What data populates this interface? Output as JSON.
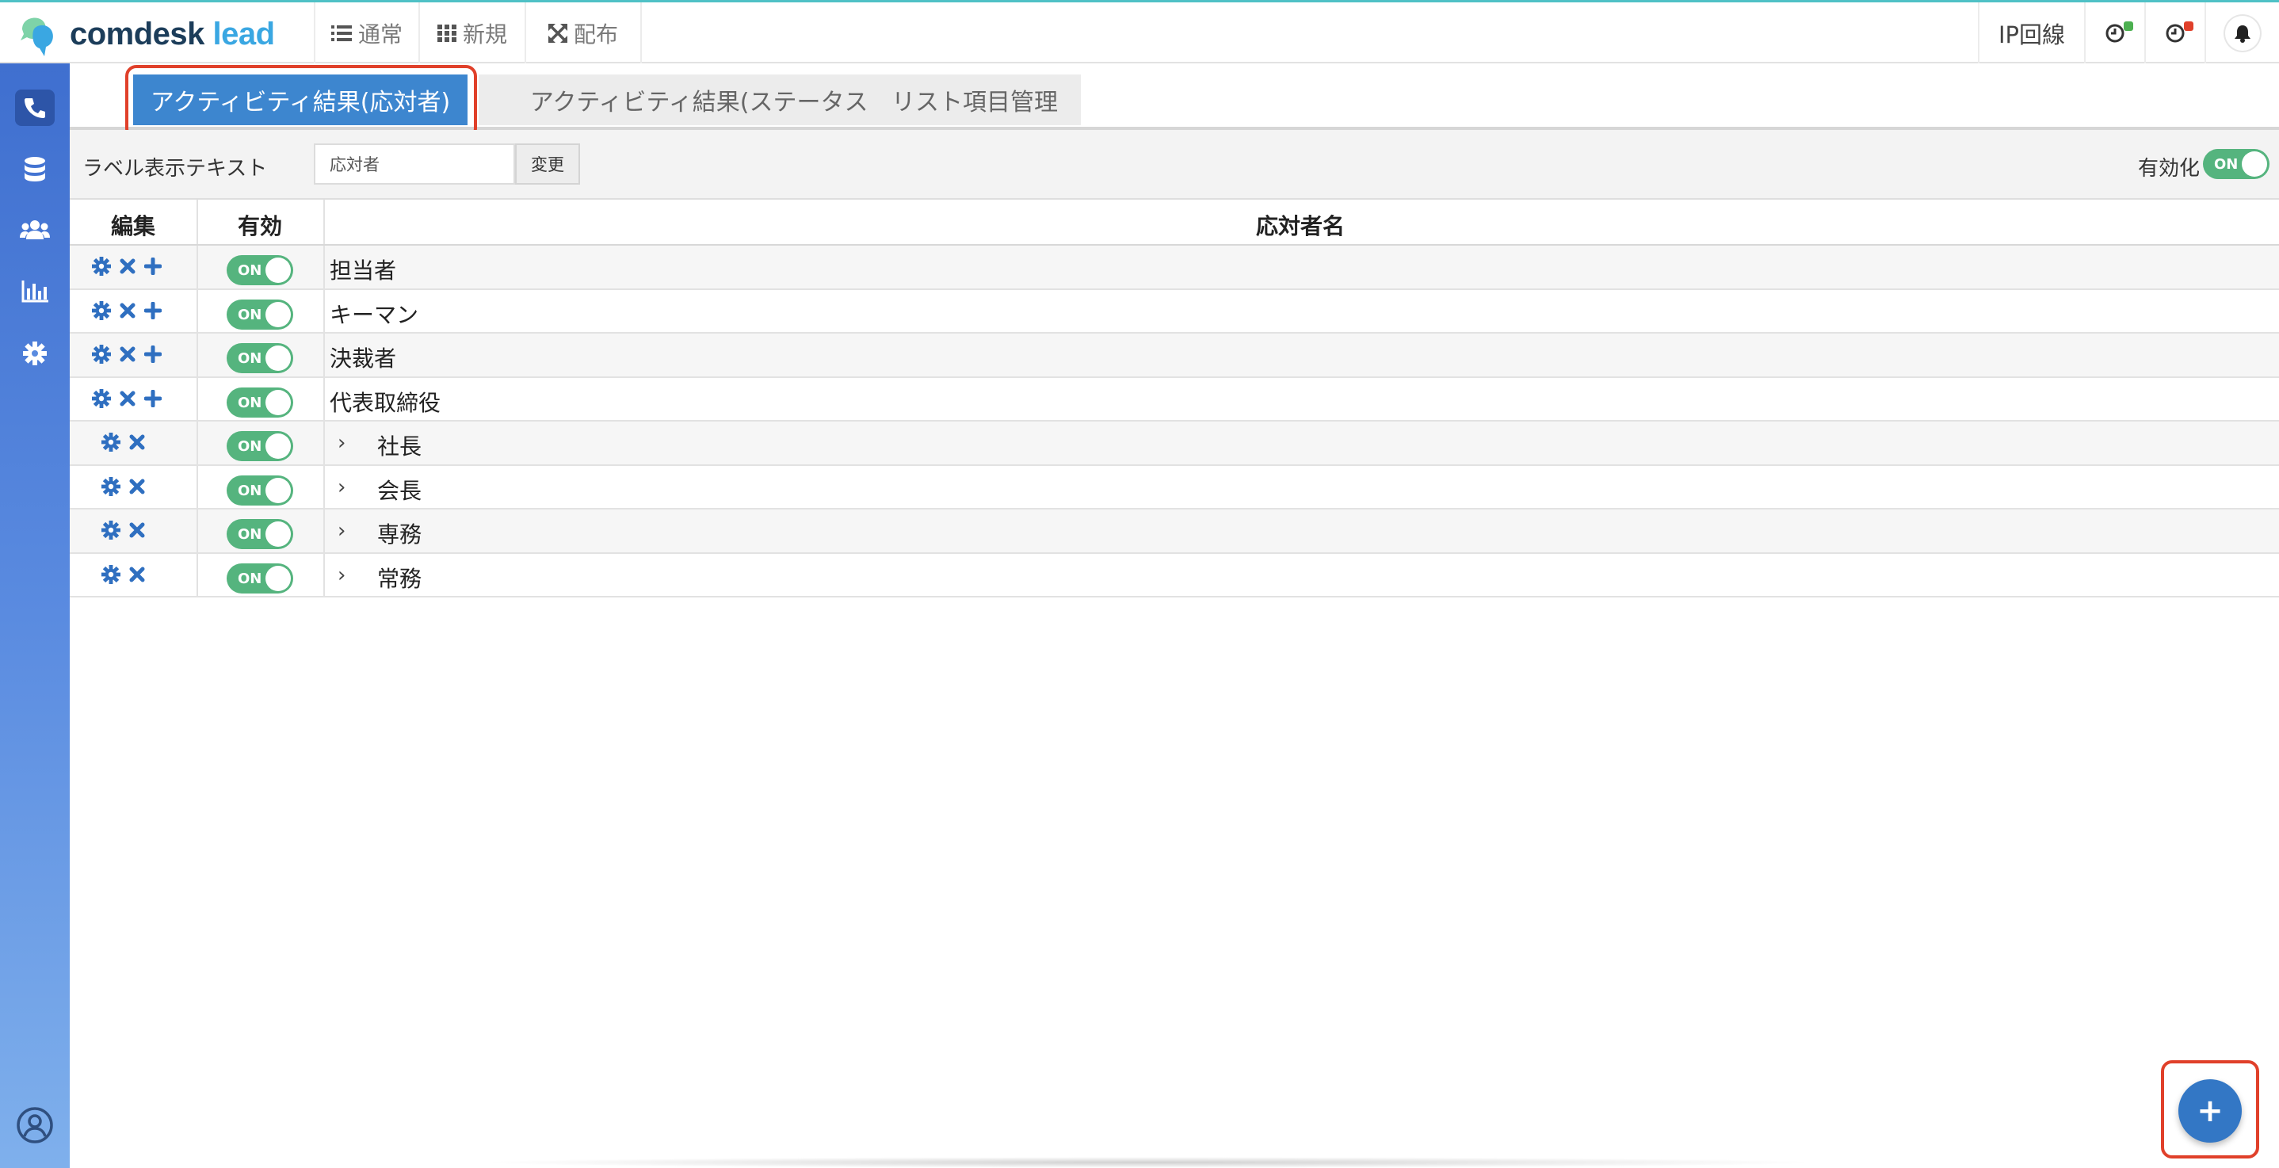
{
  "header": {
    "logo_main": "comdesk",
    "logo_sub": "lead",
    "nav": [
      {
        "label": "通常",
        "icon": "list-icon"
      },
      {
        "label": "新規",
        "icon": "grid-icon"
      },
      {
        "label": "配布",
        "icon": "expand-arrows-icon"
      }
    ],
    "ip_line": "IP回線",
    "timer_badge_1_color": "#4cb050",
    "timer_badge_2_color": "#e0402a"
  },
  "sidebar": {
    "items": [
      {
        "icon": "phone-icon",
        "active": true
      },
      {
        "icon": "database-icon"
      },
      {
        "icon": "users-icon"
      },
      {
        "icon": "bar-chart-icon"
      },
      {
        "icon": "gear-icon"
      }
    ],
    "bottom_icon": "user-circle-icon"
  },
  "tabs": [
    {
      "label": "アクティビティ結果(応対者)",
      "active": true
    },
    {
      "label": "アクティビティ結果(ステータス)"
    },
    {
      "label": "リスト項目管理"
    }
  ],
  "label_row": {
    "label": "ラベル表示テキスト",
    "input_value": "応対者",
    "change_button": "変更",
    "enable_label": "有効化",
    "enable_toggle": "ON"
  },
  "table": {
    "headers": {
      "edit": "編集",
      "enabled": "有効",
      "name": "応対者名"
    },
    "rows": [
      {
        "name": "担当者",
        "toggle": "ON",
        "child": false
      },
      {
        "name": "キーマン",
        "toggle": "ON",
        "child": false
      },
      {
        "name": "決裁者",
        "toggle": "ON",
        "child": false
      },
      {
        "name": "代表取締役",
        "toggle": "ON",
        "child": false
      },
      {
        "name": "社長",
        "toggle": "ON",
        "child": true
      },
      {
        "name": "会長",
        "toggle": "ON",
        "child": true
      },
      {
        "name": "専務",
        "toggle": "ON",
        "child": true
      },
      {
        "name": "常務",
        "toggle": "ON",
        "child": true
      }
    ],
    "chevron": "›"
  },
  "fab": {
    "label": "+"
  },
  "colors": {
    "accent": "#3d86cf",
    "toggle_on": "#55b47e",
    "highlight": "#e0402a"
  }
}
